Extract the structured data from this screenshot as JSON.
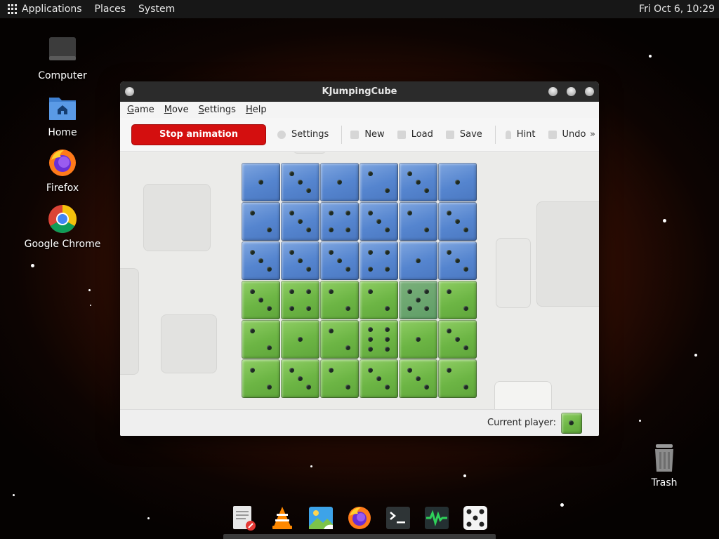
{
  "top_panel": {
    "menus": [
      "Applications",
      "Places",
      "System"
    ],
    "clock": "Fri Oct  6, 10:29"
  },
  "desktop_icons": [
    {
      "label": "Computer",
      "icon": "computer-icon"
    },
    {
      "label": "Home",
      "icon": "home-folder-icon"
    },
    {
      "label": "Firefox",
      "icon": "firefox-icon"
    },
    {
      "label": "Google Chrome",
      "icon": "chrome-icon"
    },
    {
      "label": "Trash",
      "icon": "trash-icon"
    }
  ],
  "window": {
    "title": "KJumpingCube",
    "menu": [
      {
        "label": "Game",
        "mnemonic": "G"
      },
      {
        "label": "Move",
        "mnemonic": "M"
      },
      {
        "label": "Settings",
        "mnemonic": "S"
      },
      {
        "label": "Help",
        "mnemonic": "H"
      }
    ],
    "toolbar": {
      "stop_label": "Stop animation",
      "settings_label": "Settings",
      "new_label": "New",
      "load_label": "Load",
      "save_label": "Save",
      "hint_label": "Hint",
      "undo_label": "Undo",
      "more_label": "»"
    },
    "status": {
      "current_player_label": "Current player:",
      "current_player_color": "green",
      "current_player_pips": 1
    }
  },
  "board": {
    "size": 6,
    "colors": {
      "blue": "#5585cf",
      "green": "#6cb544",
      "accent_red": "#d40f0f"
    },
    "cells": [
      [
        {
          "owner": "blue",
          "pips": 1
        },
        {
          "owner": "blue",
          "pips": 3
        },
        {
          "owner": "blue",
          "pips": 1
        },
        {
          "owner": "blue",
          "pips": 2
        },
        {
          "owner": "blue",
          "pips": 3
        },
        {
          "owner": "blue",
          "pips": 1
        }
      ],
      [
        {
          "owner": "blue",
          "pips": 2
        },
        {
          "owner": "blue",
          "pips": 3
        },
        {
          "owner": "blue",
          "pips": 4
        },
        {
          "owner": "blue",
          "pips": 3
        },
        {
          "owner": "blue",
          "pips": 2
        },
        {
          "owner": "blue",
          "pips": 3
        }
      ],
      [
        {
          "owner": "blue",
          "pips": 3
        },
        {
          "owner": "blue",
          "pips": 3
        },
        {
          "owner": "blue",
          "pips": 3
        },
        {
          "owner": "blue",
          "pips": 4
        },
        {
          "owner": "blue",
          "pips": 1
        },
        {
          "owner": "blue",
          "pips": 3
        }
      ],
      [
        {
          "owner": "green",
          "pips": 3
        },
        {
          "owner": "green",
          "pips": 4
        },
        {
          "owner": "green",
          "pips": 2
        },
        {
          "owner": "green",
          "pips": 2
        },
        {
          "owner": "green",
          "pips": 5,
          "selected": true
        },
        {
          "owner": "green",
          "pips": 2
        }
      ],
      [
        {
          "owner": "green",
          "pips": 2
        },
        {
          "owner": "green",
          "pips": 1
        },
        {
          "owner": "green",
          "pips": 2
        },
        {
          "owner": "green",
          "pips": 6
        },
        {
          "owner": "green",
          "pips": 1
        },
        {
          "owner": "green",
          "pips": 3
        }
      ],
      [
        {
          "owner": "green",
          "pips": 2
        },
        {
          "owner": "green",
          "pips": 3
        },
        {
          "owner": "green",
          "pips": 2
        },
        {
          "owner": "green",
          "pips": 3
        },
        {
          "owner": "green",
          "pips": 3
        },
        {
          "owner": "green",
          "pips": 2
        }
      ]
    ]
  },
  "dock": [
    {
      "name": "text-editor-icon"
    },
    {
      "name": "vlc-icon"
    },
    {
      "name": "image-viewer-icon"
    },
    {
      "name": "firefox-icon"
    },
    {
      "name": "terminal-icon"
    },
    {
      "name": "system-monitor-icon"
    },
    {
      "name": "dice-game-icon"
    }
  ]
}
